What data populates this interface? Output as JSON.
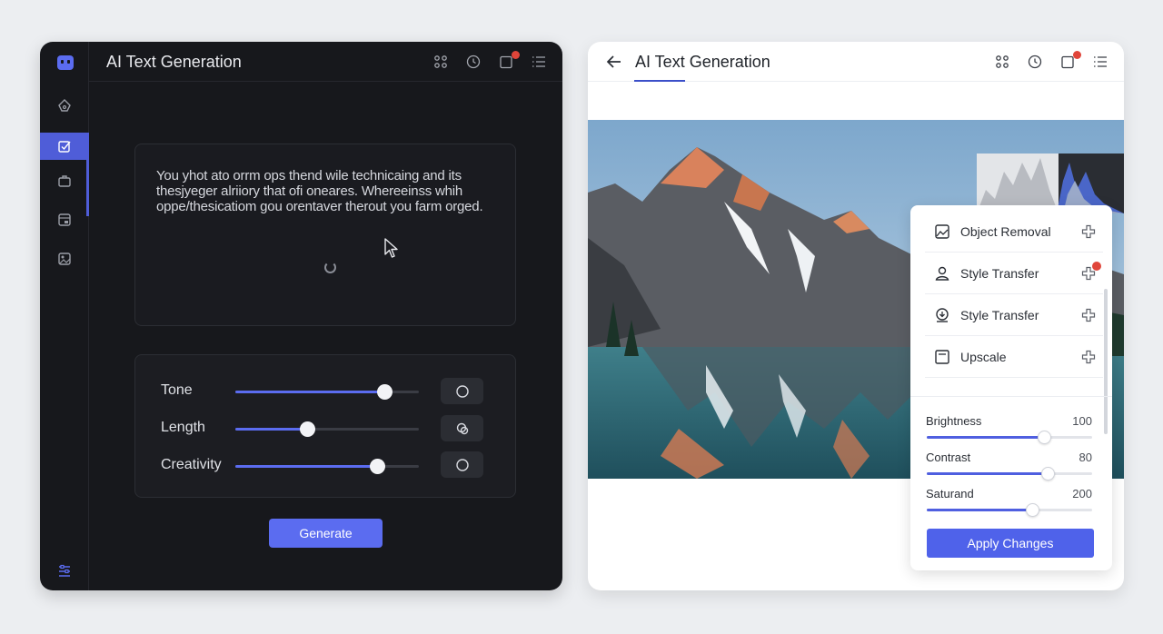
{
  "left_app": {
    "title": "AI Text Generation",
    "generated_text": "You yhot ato orrm ops thend wile technicaing and its thesjyeger alriiory that ofi oneares. Whereeinss whih oppe/thesicatiom gou orentaver therout you farm orged.",
    "controls": [
      {
        "label": "Tone",
        "level": 0.81
      },
      {
        "label": "Length",
        "level": 0.39
      },
      {
        "label": "Creativity",
        "level": 0.77
      }
    ],
    "generate_label": "Generate",
    "accent_color": "#5b6cf0",
    "notification_dot": true
  },
  "right_app": {
    "title": "AI Text Generation",
    "tools": [
      {
        "label": "Object Removal",
        "icon": "image-icon",
        "badge": false
      },
      {
        "label": "Style Transfer",
        "icon": "person-icon",
        "badge": true
      },
      {
        "label": "Style Transfer",
        "icon": "download-icon",
        "badge": false
      },
      {
        "label": "Upscale",
        "icon": "frame-icon",
        "badge": false
      }
    ],
    "adjustments": [
      {
        "label": "Brightness",
        "value": "100",
        "level": 0.71
      },
      {
        "label": "Contrast",
        "value": "80",
        "level": 0.73
      },
      {
        "label": "Saturand",
        "value": "200",
        "level": 0.64
      }
    ],
    "apply_label": "Apply Changes",
    "accent_color": "#4f62ea"
  }
}
